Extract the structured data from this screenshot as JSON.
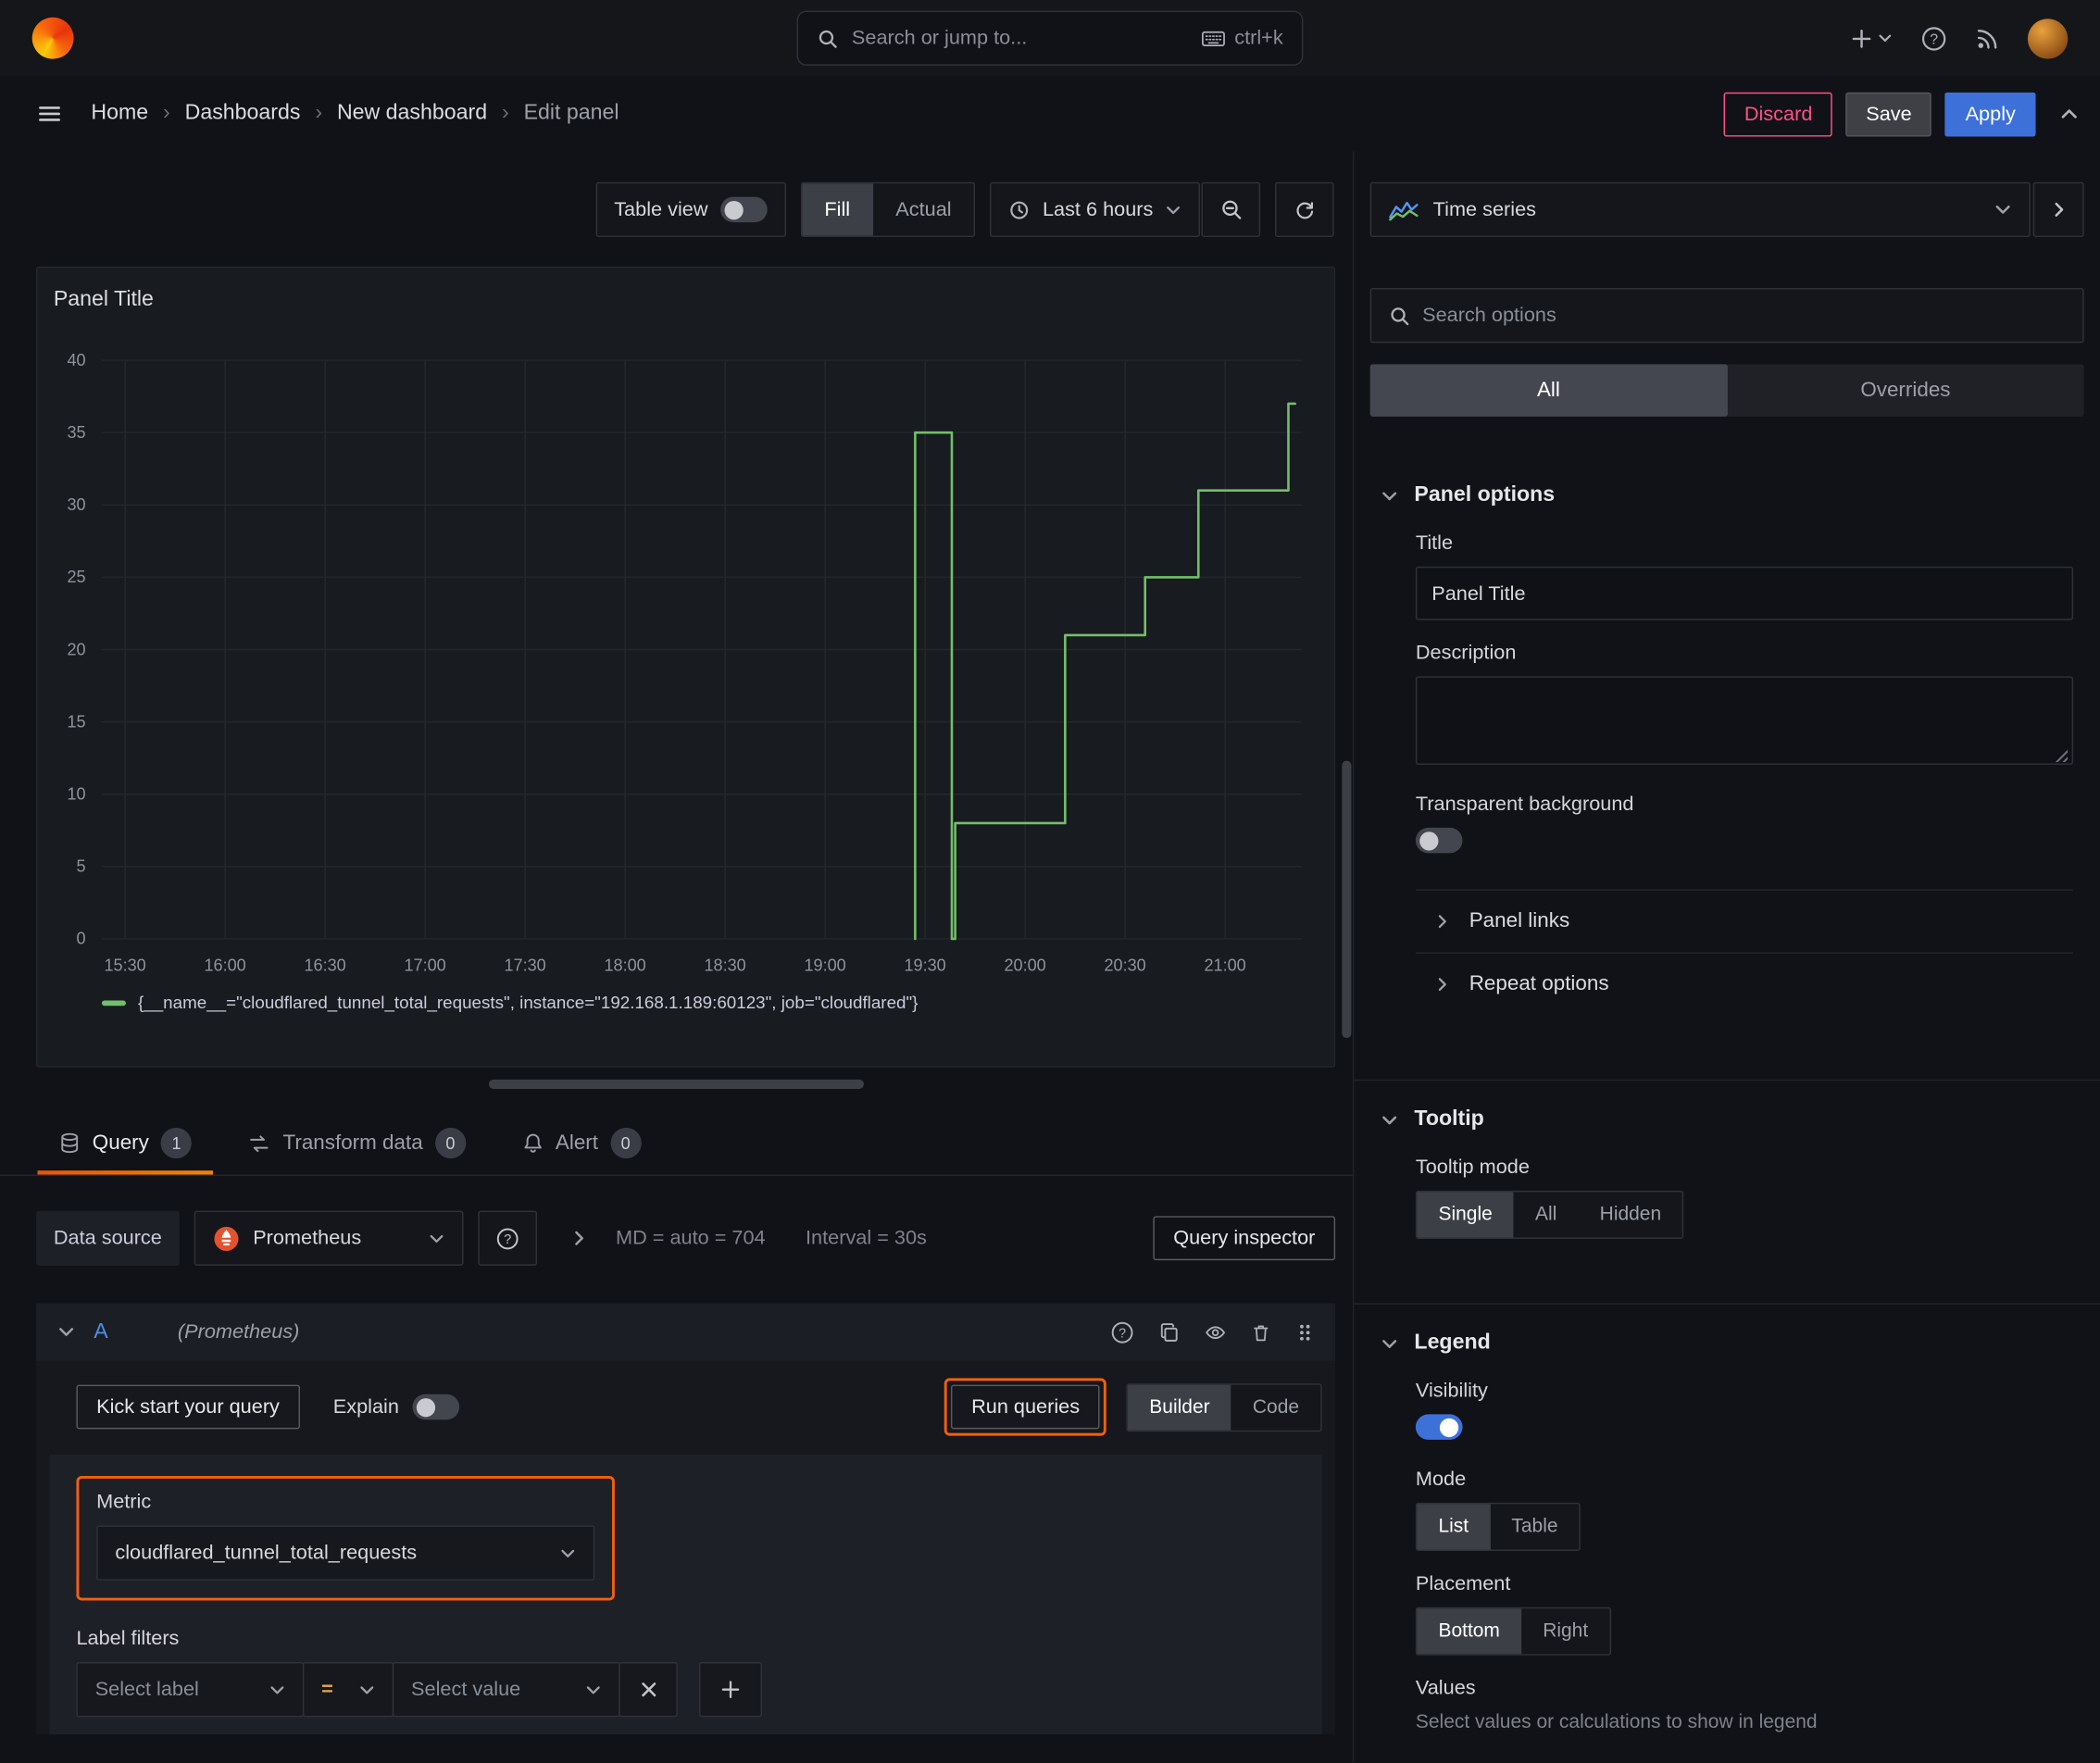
{
  "colors": {
    "accent_blue": "#3d71d9",
    "accent_orange": "#f55f0c",
    "destructive": "#ff5286",
    "series_green": "#73bf69",
    "ref_blue": "#4f8fe8",
    "operator_amber": "#e8a84e"
  },
  "top_nav": {
    "search_placeholder": "Search or jump to...",
    "search_shortcut": "ctrl+k"
  },
  "breadcrumb_bar": {
    "items": [
      {
        "label": "Home"
      },
      {
        "label": "Dashboards"
      },
      {
        "label": "New dashboard"
      },
      {
        "label": "Edit panel"
      }
    ],
    "discard_label": "Discard",
    "save_label": "Save",
    "apply_label": "Apply"
  },
  "panel_toolbar": {
    "table_view_label": "Table view",
    "fill_label": "Fill",
    "actual_label": "Actual",
    "time_range_label": "Last 6 hours"
  },
  "panel": {
    "title": "Panel Title"
  },
  "chart_data": {
    "type": "line",
    "line_style": "step-after",
    "title": "Panel Title",
    "xlabel": "",
    "ylabel": "",
    "grid": true,
    "legend_position": "bottom",
    "x_domain": [
      "15:23",
      "21:23"
    ],
    "x_ticks": [
      "15:30",
      "16:00",
      "16:30",
      "17:00",
      "17:30",
      "18:00",
      "18:30",
      "19:00",
      "19:30",
      "20:00",
      "20:30",
      "21:00"
    ],
    "ylim": [
      0,
      40
    ],
    "y_ticks": [
      0,
      5,
      10,
      15,
      20,
      25,
      30,
      35,
      40
    ],
    "series": [
      {
        "name": "{__name__=\"cloudflared_tunnel_total_requests\", instance=\"192.168.1.189:60123\", job=\"cloudflared\"}",
        "color": "#73bf69",
        "points": [
          {
            "t": "19:27",
            "v": 0
          },
          {
            "t": "19:27",
            "v": 35
          },
          {
            "t": "19:38",
            "v": 35
          },
          {
            "t": "19:38",
            "v": 0
          },
          {
            "t": "19:39",
            "v": 0
          },
          {
            "t": "19:39",
            "v": 8
          },
          {
            "t": "20:12",
            "v": 8
          },
          {
            "t": "20:12",
            "v": 21
          },
          {
            "t": "20:36",
            "v": 21
          },
          {
            "t": "20:36",
            "v": 25
          },
          {
            "t": "20:52",
            "v": 25
          },
          {
            "t": "20:52",
            "v": 31
          },
          {
            "t": "21:19",
            "v": 31
          },
          {
            "t": "21:19",
            "v": 37
          },
          {
            "t": "21:21",
            "v": 37
          }
        ]
      }
    ]
  },
  "query_tabs": {
    "query_label": "Query",
    "query_count": "1",
    "transform_label": "Transform data",
    "transform_count": "0",
    "alert_label": "Alert",
    "alert_count": "0"
  },
  "datasource_row": {
    "label": "Data source",
    "selected": "Prometheus",
    "stats": "MD = auto = 704",
    "interval": "Interval = 30s",
    "query_inspector_label": "Query inspector"
  },
  "query_editor": {
    "ref_id": "A",
    "datasource_hint": "(Prometheus)",
    "kick_start_label": "Kick start your query",
    "explain_label": "Explain",
    "run_queries_label": "Run queries",
    "builder_label": "Builder",
    "code_label": "Code",
    "metric_label": "Metric",
    "metric_value": "cloudflared_tunnel_total_requests",
    "label_filters_label": "Label filters",
    "select_label_placeholder": "Select label",
    "operator_value": "=",
    "select_value_placeholder": "Select value"
  },
  "sidebar": {
    "viz_picker": "Time series",
    "search_placeholder": "Search options",
    "tabs": {
      "all": "All",
      "overrides": "Overrides"
    },
    "panel_options": {
      "title": "Panel options",
      "title_label": "Title",
      "title_value": "Panel Title",
      "description_label": "Description",
      "transparent_label": "Transparent background",
      "panel_links_label": "Panel links",
      "repeat_options_label": "Repeat options"
    },
    "tooltip": {
      "title": "Tooltip",
      "mode_label": "Tooltip mode",
      "modes": [
        "Single",
        "All",
        "Hidden"
      ],
      "selected_mode": "Single"
    },
    "legend": {
      "title": "Legend",
      "visibility_label": "Visibility",
      "mode_label": "Mode",
      "modes": [
        "List",
        "Table"
      ],
      "selected_mode": "List",
      "placement_label": "Placement",
      "placements": [
        "Bottom",
        "Right"
      ],
      "selected_placement": "Bottom",
      "values_label": "Values",
      "values_hint": "Select values or calculations to show in legend"
    }
  },
  "states": {
    "table_view_on": false,
    "explain_on": false,
    "transparent_background_on": false,
    "legend_visibility_on": true,
    "selected_fill_mode": "Fill",
    "selected_editor_mode": "Builder",
    "selected_options_tab": "All"
  }
}
